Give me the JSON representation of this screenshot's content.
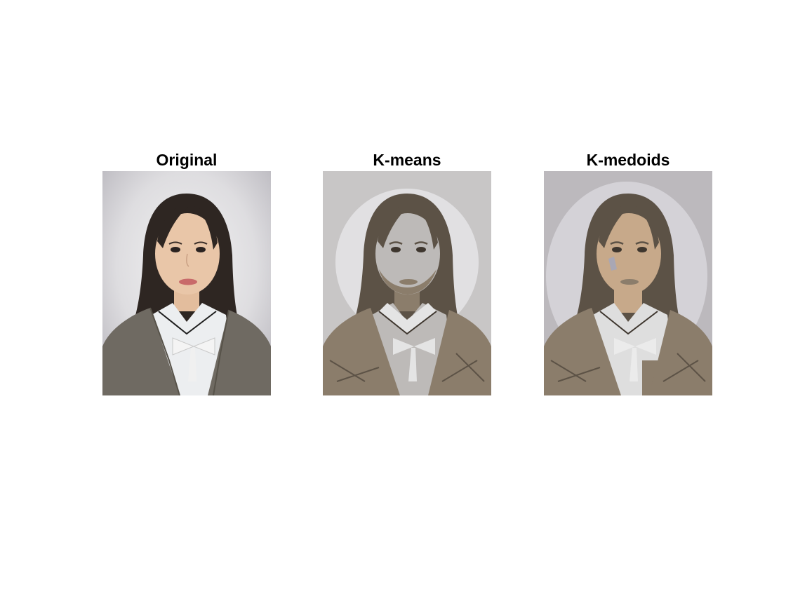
{
  "figure": {
    "panels": [
      {
        "title": "Original"
      },
      {
        "title": "K-means"
      },
      {
        "title": "K-medoids"
      }
    ]
  },
  "colors": {
    "background": "#ffffff",
    "original": {
      "backdrop_center": "#f2f2f2",
      "backdrop_edge": "#b3b1b8",
      "hair": "#2e2622",
      "skin": "#e9c6a8",
      "blazer": "#6f6a62",
      "shirt": "#eceef0",
      "lips": "#c86a6a"
    },
    "kmeans": {
      "background": "#c8c6c6",
      "halo": "#e1e0e2",
      "dark": "#5c5246",
      "mid": "#8b7d6b",
      "light": "#bdbab8",
      "white": "#e4e4e4"
    },
    "kmedoids": {
      "background": "#bcb9bd",
      "halo": "#d4d2d7",
      "dark": "#5c5246",
      "mid": "#8b7d6b",
      "skin": "#c7a98a",
      "white": "#dedede"
    }
  }
}
